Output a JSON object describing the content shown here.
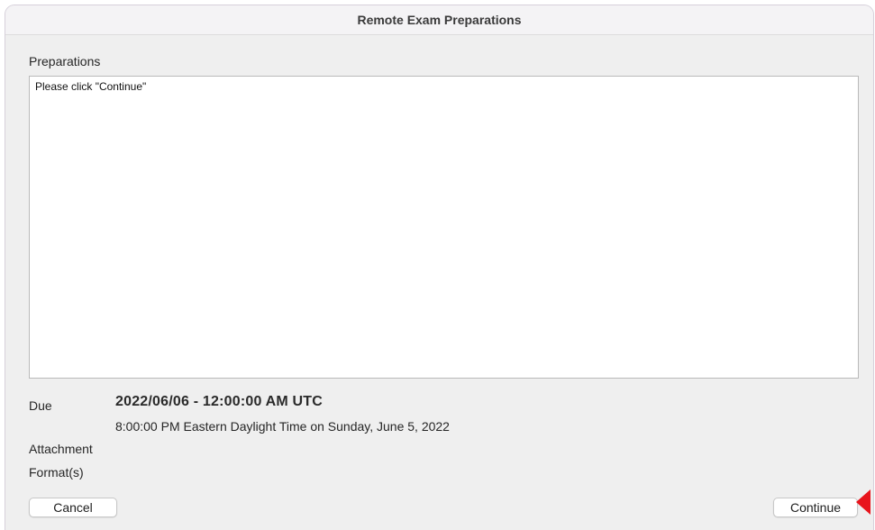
{
  "window": {
    "title": "Remote Exam Preparations"
  },
  "preparations": {
    "label": "Preparations",
    "text": "Please click \"Continue\""
  },
  "due": {
    "label": "Due",
    "datetime_utc": "2022/06/06 - 12:00:00 AM UTC",
    "local_time": "8:00:00 PM Eastern Daylight Time on Sunday, June 5, 2022"
  },
  "attachment": {
    "label": "Attachment"
  },
  "formats": {
    "label": "Format(s)"
  },
  "buttons": {
    "cancel": "Cancel",
    "continue": "Continue"
  },
  "colors": {
    "pointer": "#e8141c",
    "window_bg": "#efefef"
  },
  "icons": {
    "pointer": "red-pointer-arrow-icon"
  }
}
